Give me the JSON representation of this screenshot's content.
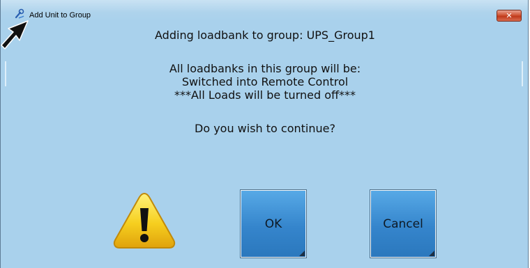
{
  "window": {
    "title": "Add Unit to Group",
    "close_glyph": "✕",
    "icon": "wrench-app-icon"
  },
  "message": {
    "line1": "Adding loadbank to group: UPS_Group1",
    "line2": "All loadbanks in this group will be:",
    "line3": "Switched into Remote Control",
    "line4": "***All Loads will be turned off***",
    "line5": "Do you wish to continue?"
  },
  "buttons": {
    "ok_label": "OK",
    "cancel_label": "Cancel"
  },
  "icons": {
    "warning": "warning-icon"
  },
  "colors": {
    "dialog_background": "#a9d1ec",
    "button_blue": "#3585cc",
    "close_red": "#c0391b",
    "warning_yellow": "#f6cf1f"
  }
}
